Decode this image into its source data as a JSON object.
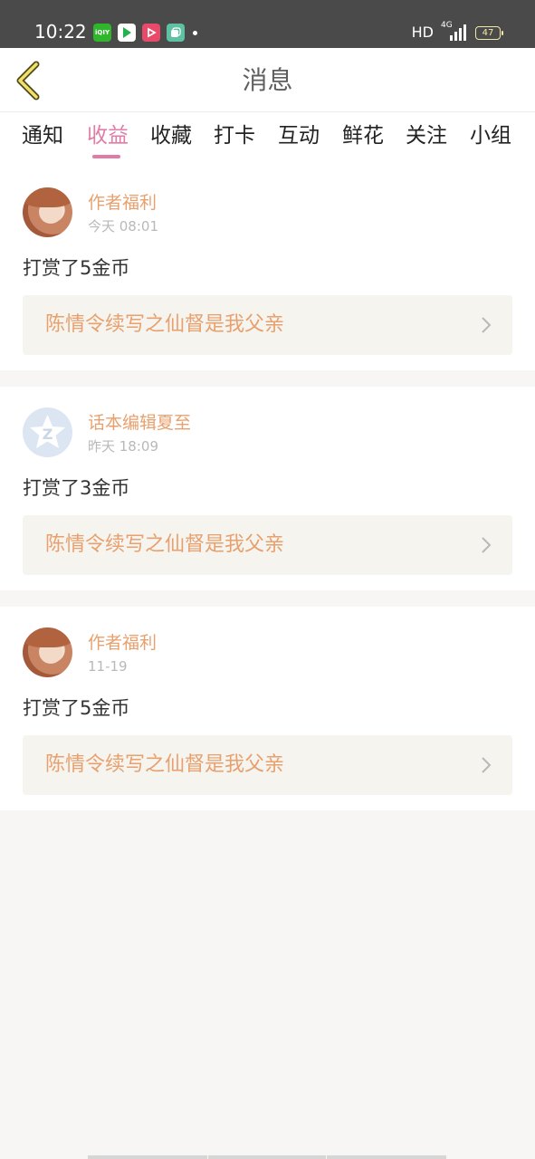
{
  "status_bar": {
    "time": "10:22",
    "apps": [
      "iqiyi",
      "tencent-video",
      "app-red",
      "app-green"
    ],
    "iqiyi_label": "iQIY",
    "network": "HD",
    "signal_label": "4G",
    "battery": "47"
  },
  "header": {
    "title": "消息"
  },
  "tabs": [
    {
      "label": "通知",
      "active": false
    },
    {
      "label": "收益",
      "active": true
    },
    {
      "label": "收藏",
      "active": false
    },
    {
      "label": "打卡",
      "active": false
    },
    {
      "label": "互动",
      "active": false
    },
    {
      "label": "鲜花",
      "active": false
    },
    {
      "label": "关注",
      "active": false
    },
    {
      "label": "小组",
      "active": false
    }
  ],
  "messages": [
    {
      "sender": "作者福利",
      "time": "今天 08:01",
      "text": "打赏了5金币",
      "work": "陈情令续写之仙督是我父亲",
      "avatar": "anime-girl"
    },
    {
      "sender": "话本编辑夏至",
      "time": "昨天 18:09",
      "text": "打赏了3金币",
      "work": "陈情令续写之仙督是我父亲",
      "avatar": "editor-logo"
    },
    {
      "sender": "作者福利",
      "time": "11-19",
      "text": "打赏了5金币",
      "work": "陈情令续写之仙督是我父亲",
      "avatar": "anime-girl"
    }
  ],
  "colors": {
    "accent": "#e07ca6",
    "sender": "#e8a06e",
    "link_bg": "#f5f4ef",
    "status_bar": "#4a4a4a"
  }
}
